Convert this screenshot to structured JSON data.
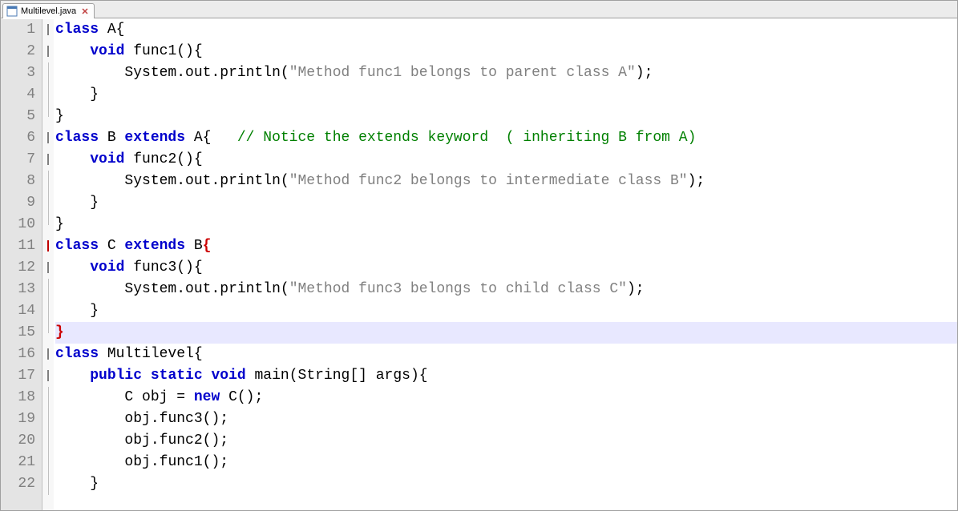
{
  "tab": {
    "filename": "Multilevel.java"
  },
  "code": {
    "lines": [
      {
        "num": 1,
        "fold": "box",
        "seg": [
          [
            "kw",
            "class"
          ],
          [
            "plain",
            " A"
          ],
          [
            "punc",
            "{"
          ]
        ]
      },
      {
        "num": 2,
        "fold": "box",
        "seg": [
          [
            "plain",
            "    "
          ],
          [
            "kw",
            "void"
          ],
          [
            "plain",
            " func1"
          ],
          [
            "punc",
            "(){"
          ]
        ]
      },
      {
        "num": 3,
        "fold": "line",
        "seg": [
          [
            "plain",
            "        System"
          ],
          [
            "punc",
            "."
          ],
          [
            "plain",
            "out"
          ],
          [
            "punc",
            "."
          ],
          [
            "plain",
            "println"
          ],
          [
            "punc",
            "("
          ],
          [
            "str",
            "\"Method func1 belongs to parent class A\""
          ],
          [
            "punc",
            ");"
          ]
        ]
      },
      {
        "num": 4,
        "fold": "line",
        "seg": [
          [
            "plain",
            "    "
          ],
          [
            "punc",
            "}"
          ]
        ]
      },
      {
        "num": 5,
        "fold": "end",
        "seg": [
          [
            "punc",
            "}"
          ]
        ]
      },
      {
        "num": 6,
        "fold": "box",
        "seg": [
          [
            "kw",
            "class"
          ],
          [
            "plain",
            " B "
          ],
          [
            "kw",
            "extends"
          ],
          [
            "plain",
            " A"
          ],
          [
            "punc",
            "{"
          ],
          [
            "plain",
            "   "
          ],
          [
            "cmt",
            "// Notice the extends keyword  ( inheriting B from A)"
          ]
        ]
      },
      {
        "num": 7,
        "fold": "box",
        "seg": [
          [
            "plain",
            "    "
          ],
          [
            "kw",
            "void"
          ],
          [
            "plain",
            " func2"
          ],
          [
            "punc",
            "(){"
          ]
        ]
      },
      {
        "num": 8,
        "fold": "line",
        "seg": [
          [
            "plain",
            "        System"
          ],
          [
            "punc",
            "."
          ],
          [
            "plain",
            "out"
          ],
          [
            "punc",
            "."
          ],
          [
            "plain",
            "println"
          ],
          [
            "punc",
            "("
          ],
          [
            "str",
            "\"Method func2 belongs to intermediate class B\""
          ],
          [
            "punc",
            ");"
          ]
        ]
      },
      {
        "num": 9,
        "fold": "line",
        "seg": [
          [
            "plain",
            "    "
          ],
          [
            "punc",
            "}"
          ]
        ]
      },
      {
        "num": 10,
        "fold": "end",
        "seg": [
          [
            "punc",
            "}"
          ]
        ]
      },
      {
        "num": 11,
        "fold": "box-red",
        "seg": [
          [
            "kw",
            "class"
          ],
          [
            "plain",
            " C "
          ],
          [
            "kw",
            "extends"
          ],
          [
            "plain",
            " B"
          ],
          [
            "bracket-r",
            "{"
          ]
        ]
      },
      {
        "num": 12,
        "fold": "box",
        "seg": [
          [
            "plain",
            "    "
          ],
          [
            "kw",
            "void"
          ],
          [
            "plain",
            " func3"
          ],
          [
            "punc",
            "(){"
          ]
        ]
      },
      {
        "num": 13,
        "fold": "line",
        "seg": [
          [
            "plain",
            "        System"
          ],
          [
            "punc",
            "."
          ],
          [
            "plain",
            "out"
          ],
          [
            "punc",
            "."
          ],
          [
            "plain",
            "println"
          ],
          [
            "punc",
            "("
          ],
          [
            "str",
            "\"Method func3 belongs to child class C\""
          ],
          [
            "punc",
            ");"
          ]
        ]
      },
      {
        "num": 14,
        "fold": "line",
        "seg": [
          [
            "plain",
            "    "
          ],
          [
            "punc",
            "}"
          ]
        ]
      },
      {
        "num": 15,
        "fold": "end",
        "hl": true,
        "seg": [
          [
            "bracket-r",
            "}"
          ]
        ]
      },
      {
        "num": 16,
        "fold": "box",
        "seg": [
          [
            "kw",
            "class"
          ],
          [
            "plain",
            " Multilevel"
          ],
          [
            "punc",
            "{"
          ]
        ]
      },
      {
        "num": 17,
        "fold": "box",
        "seg": [
          [
            "plain",
            "    "
          ],
          [
            "kw",
            "public"
          ],
          [
            "plain",
            " "
          ],
          [
            "kw",
            "static"
          ],
          [
            "plain",
            " "
          ],
          [
            "kw",
            "void"
          ],
          [
            "plain",
            " main"
          ],
          [
            "punc",
            "("
          ],
          [
            "plain",
            "String"
          ],
          [
            "punc",
            "[]"
          ],
          [
            "plain",
            " args"
          ],
          [
            "punc",
            "){"
          ]
        ]
      },
      {
        "num": 18,
        "fold": "line",
        "seg": [
          [
            "plain",
            "        C obj "
          ],
          [
            "punc",
            "="
          ],
          [
            "plain",
            " "
          ],
          [
            "kw",
            "new"
          ],
          [
            "plain",
            " C"
          ],
          [
            "punc",
            "();"
          ]
        ]
      },
      {
        "num": 19,
        "fold": "line",
        "seg": [
          [
            "plain",
            "        obj"
          ],
          [
            "punc",
            "."
          ],
          [
            "plain",
            "func3"
          ],
          [
            "punc",
            "();"
          ]
        ]
      },
      {
        "num": 20,
        "fold": "line",
        "seg": [
          [
            "plain",
            "        obj"
          ],
          [
            "punc",
            "."
          ],
          [
            "plain",
            "func2"
          ],
          [
            "punc",
            "();"
          ]
        ]
      },
      {
        "num": 21,
        "fold": "line",
        "seg": [
          [
            "plain",
            "        obj"
          ],
          [
            "punc",
            "."
          ],
          [
            "plain",
            "func1"
          ],
          [
            "punc",
            "();"
          ]
        ]
      },
      {
        "num": 22,
        "fold": "line",
        "seg": [
          [
            "plain",
            "    "
          ],
          [
            "punc",
            "}"
          ]
        ]
      }
    ]
  }
}
